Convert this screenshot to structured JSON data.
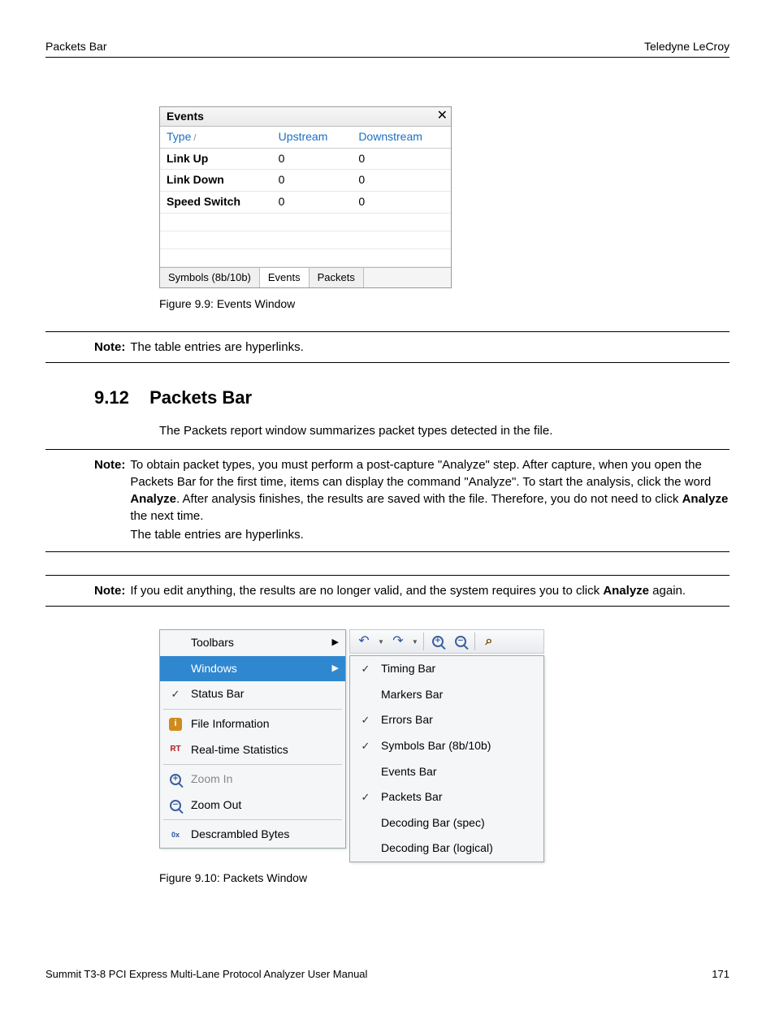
{
  "header": {
    "left": "Packets Bar",
    "right": "Teledyne LeCroy"
  },
  "fig99": {
    "title": "Events",
    "columns": [
      "Type",
      "Upstream",
      "Downstream"
    ],
    "rows": [
      {
        "type": "Link Up",
        "up": "0",
        "down": "0"
      },
      {
        "type": "Link Down",
        "up": "0",
        "down": "0"
      },
      {
        "type": "Speed Switch",
        "up": "0",
        "down": "0"
      }
    ],
    "tabs": [
      "Symbols (8b/10b)",
      "Events",
      "Packets"
    ],
    "active_tab": 1,
    "caption": "Figure 9.9:  Events Window"
  },
  "note1": {
    "label": "Note:",
    "text": "The table entries are hyperlinks."
  },
  "section": {
    "num": "9.12",
    "title": "Packets Bar"
  },
  "intro": "The Packets report window summarizes packet types detected in the file.",
  "note2": {
    "label": "Note:",
    "lines": [
      "To obtain packet types, you must perform a post-capture \"Analyze\" step. After capture, when you open the Packets Bar for the first time, items can display the command \"Analyze\". To start the analysis, click the word ",
      ". After analysis finishes, the results are saved with the file. Therefore, you do not need to click ",
      " the next time.",
      "The table entries are hyperlinks."
    ],
    "bold1": "Analyze",
    "bold2": "Analyze"
  },
  "note3": {
    "label": "Note:",
    "pre": "If you edit anything, the results are no longer valid, and the system requires you to click ",
    "bold": "Analyze",
    "post": " again."
  },
  "fig910": {
    "left_menu": [
      {
        "label": "Toolbars",
        "icon": "",
        "arrow": true
      },
      {
        "label": "Windows",
        "icon": "",
        "arrow": true,
        "highlight": true
      },
      {
        "label": "Status Bar",
        "icon": "check"
      },
      {
        "sep": true
      },
      {
        "label": "File Information",
        "icon": "info"
      },
      {
        "label": "Real-time Statistics",
        "icon": "rt"
      },
      {
        "sep": true
      },
      {
        "label": "Zoom In",
        "icon": "zoomin",
        "disabled": true
      },
      {
        "label": "Zoom Out",
        "icon": "zoomout"
      },
      {
        "sep": true
      },
      {
        "label": "Descrambled Bytes",
        "icon": "descr"
      }
    ],
    "right_menu": [
      {
        "label": "Timing Bar",
        "icon": "check"
      },
      {
        "label": "Markers Bar",
        "icon": ""
      },
      {
        "label": "Errors Bar",
        "icon": "check"
      },
      {
        "label": "Symbols Bar (8b/10b)",
        "icon": "check"
      },
      {
        "label": "Events Bar",
        "icon": ""
      },
      {
        "label": "Packets Bar",
        "icon": "check"
      },
      {
        "label": "Decoding Bar (spec)",
        "icon": ""
      },
      {
        "label": "Decoding Bar (logical)",
        "icon": ""
      }
    ],
    "caption": "Figure 9.10:  Packets Window"
  },
  "footer": {
    "left": "Summit T3-8 PCI Express Multi-Lane Protocol Analyzer User Manual",
    "right": "171"
  }
}
